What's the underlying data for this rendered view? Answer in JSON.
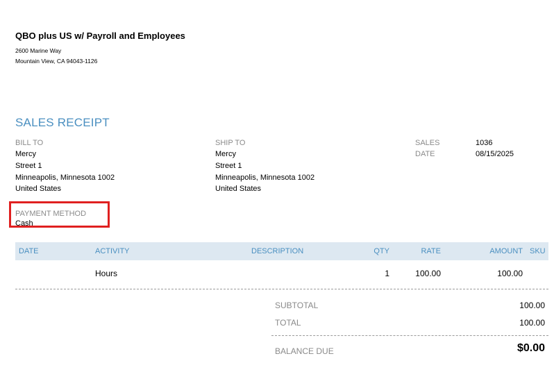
{
  "company": {
    "name": "QBO plus US w/ Payroll and Employees",
    "address_line1": "2600 Marine Way",
    "address_line2": "Mountain View, CA  94043-1126"
  },
  "document": {
    "title": "SALES RECEIPT"
  },
  "bill_to": {
    "label": "BILL TO",
    "name": "Mercy",
    "street": "Street 1",
    "city_state_zip": "Minneapolis, Minnesota  1002",
    "country": "United States"
  },
  "ship_to": {
    "label": "SHIP TO",
    "name": "Mercy",
    "street": "Street 1",
    "city_state_zip": "Minneapolis, Minnesota  1002",
    "country": "United States"
  },
  "meta": {
    "sales_label": "SALES",
    "sales_value": "1036",
    "date_label": "DATE",
    "date_value": "08/15/2025"
  },
  "payment": {
    "label": "PAYMENT METHOD",
    "value": "Cash"
  },
  "table": {
    "headers": {
      "date": "DATE",
      "activity": "ACTIVITY",
      "description": "DESCRIPTION",
      "qty": "QTY",
      "rate": "RATE",
      "amount": "AMOUNT",
      "sku": "SKU"
    },
    "rows": [
      {
        "date": "",
        "activity": "Hours",
        "description": "",
        "qty": "1",
        "rate": "100.00",
        "amount": "100.00",
        "sku": ""
      }
    ]
  },
  "summary": {
    "subtotal_label": "SUBTOTAL",
    "subtotal_value": "100.00",
    "total_label": "TOTAL",
    "total_value": "100.00",
    "balance_label": "BALANCE DUE",
    "balance_value": "$0.00"
  },
  "colors": {
    "accent": "#4a8fc0",
    "header_bg": "#dde8f1",
    "highlight": "#e02020",
    "muted": "#8a8a8a"
  }
}
